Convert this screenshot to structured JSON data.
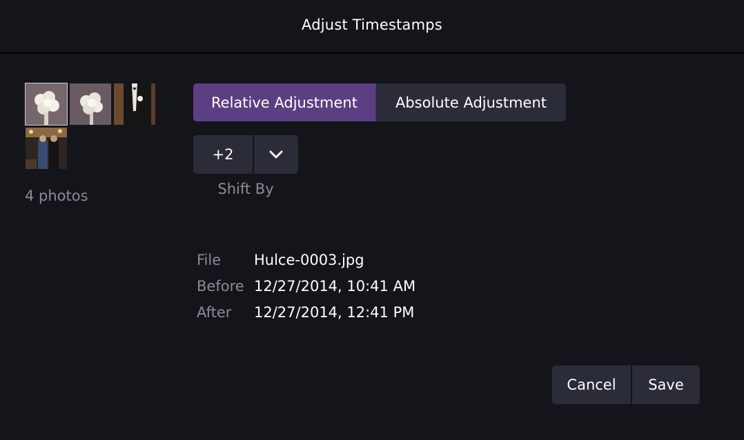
{
  "dialog": {
    "title": "Adjust Timestamps"
  },
  "thumbnails": {
    "items": [
      {
        "name": "bouquet-photo",
        "selected": true
      },
      {
        "name": "bouquet-photo",
        "selected": false
      },
      {
        "name": "tuxedo-photo",
        "selected": false
      },
      {
        "name": "dance-photo",
        "selected": false
      }
    ],
    "count_label": "4 photos"
  },
  "mode": {
    "relative_label": "Relative Adjustment",
    "absolute_label": "Absolute Adjustment",
    "active": "relative"
  },
  "shift": {
    "value": "+2",
    "label": "Shift By"
  },
  "info": {
    "file_key": "File",
    "file_val": "Hulce-0003.jpg",
    "before_key": "Before",
    "before_val": "12/27/2014, 10:41 AM",
    "after_key": "After",
    "after_val": "12/27/2014, 12:41 PM"
  },
  "actions": {
    "cancel_label": "Cancel",
    "save_label": "Save"
  },
  "colors": {
    "background": "#14151b",
    "accent": "#5c3f83",
    "button": "#2a2c38",
    "muted_text": "#8a8c96"
  }
}
